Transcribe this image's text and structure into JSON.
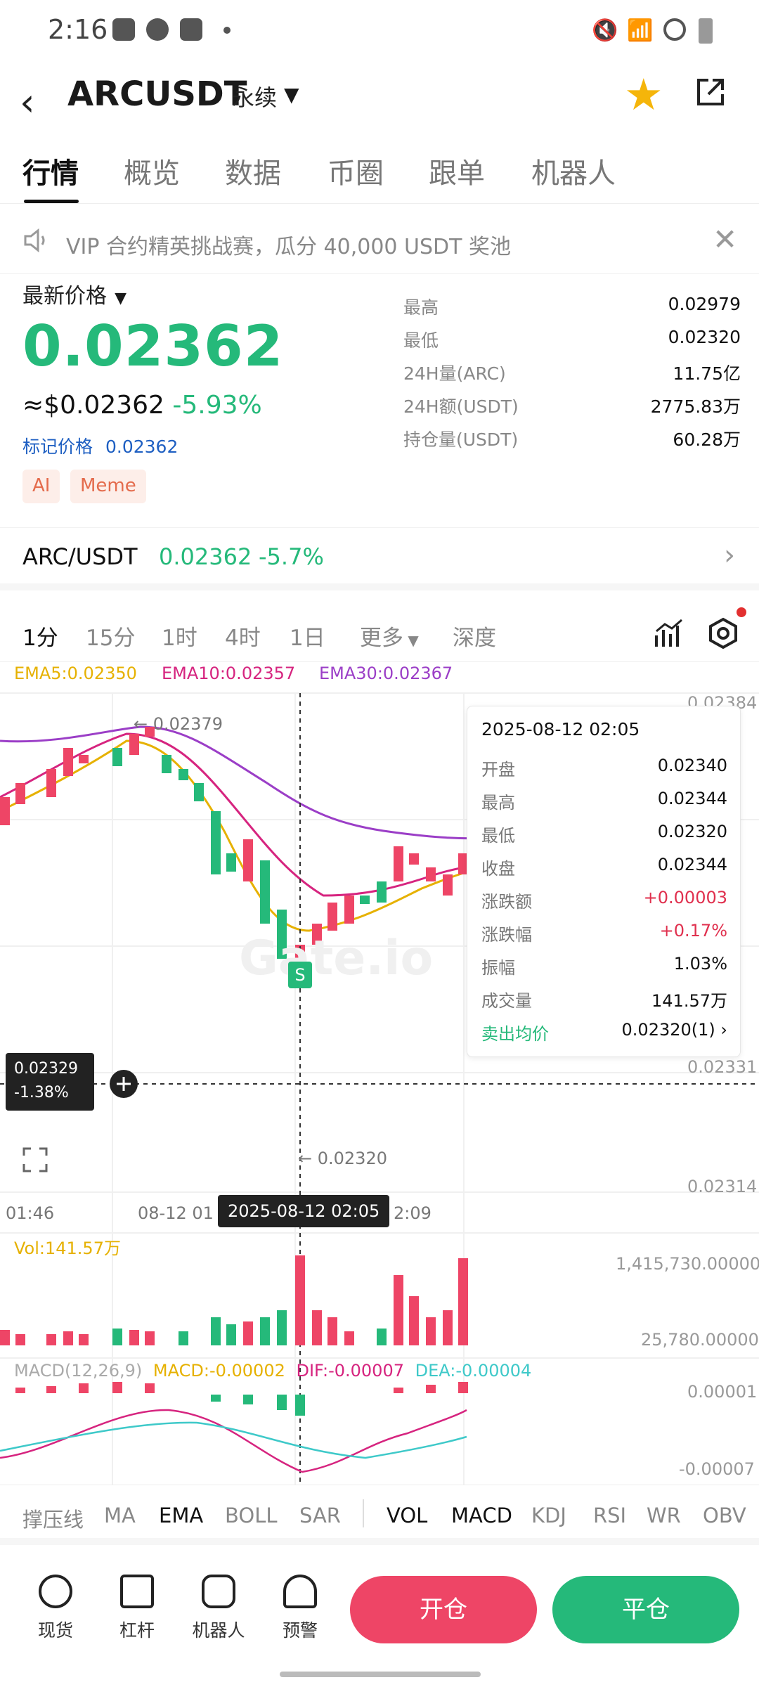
{
  "status_bar": {
    "time": "2:16"
  },
  "header": {
    "symbol": "ARCUSDT",
    "contract": "永续"
  },
  "tabs": [
    "行情",
    "概览",
    "数据",
    "币圈",
    "跟单",
    "机器人"
  ],
  "notice": "VIP 合约精英挑战赛，瓜分 40,000 USDT 奖池",
  "price": {
    "latest_label": "最新价格",
    "last": "0.02362",
    "usd": "≈$0.02362",
    "change": "-5.93%",
    "mark_label": "标记价格",
    "mark_value": "0.02362",
    "tags": [
      "AI",
      "Meme"
    ]
  },
  "stats": [
    {
      "k": "最高",
      "v": "0.02979"
    },
    {
      "k": "最低",
      "v": "0.02320"
    },
    {
      "k": "24H量(ARC)",
      "v": "11.75亿"
    },
    {
      "k": "24H额(USDT)",
      "v": "2775.83万"
    },
    {
      "k": "持仓量(USDT)",
      "v": "60.28万"
    }
  ],
  "spot_pair": {
    "name": "ARC/USDT",
    "price": "0.02362",
    "change": "-5.7%"
  },
  "timeframes": [
    "1分",
    "15分",
    "1时",
    "4时",
    "1日",
    "更多",
    "深度"
  ],
  "ema": {
    "ema5": "EMA5:0.02350",
    "ema10": "EMA10:0.02357",
    "ema30": "EMA30:0.02367"
  },
  "watermark": "Gate.io",
  "chart_labels": {
    "hi_mark": "← 0.02379",
    "lo_mark": "← 0.02320",
    "y_top": "0.02384",
    "y_mid": "0.02331",
    "y_bot": "0.02314",
    "cross_price": "0.02329",
    "cross_pct": "-1.38%",
    "x1": "01:46",
    "x2": "08-12 01",
    "x3": "2:09",
    "cross_time": "2025-08-12 02:05",
    "signal": "S"
  },
  "tooltip": {
    "datetime": "2025-08-12 02:05",
    "rows": [
      {
        "k": "开盘",
        "v": "0.02340"
      },
      {
        "k": "最高",
        "v": "0.02344"
      },
      {
        "k": "最低",
        "v": "0.02320"
      },
      {
        "k": "收盘",
        "v": "0.02344"
      },
      {
        "k": "涨跌额",
        "v": "+0.00003"
      },
      {
        "k": "涨跌幅",
        "v": "+0.17%"
      },
      {
        "k": "振幅",
        "v": "1.03%"
      },
      {
        "k": "成交量",
        "v": "141.57万"
      },
      {
        "k": "卖出均价",
        "v": "0.02320(1) ›"
      }
    ]
  },
  "volume": {
    "label": "Vol:141.57万",
    "max": "1,415,730.00000",
    "min": "25,780.00000"
  },
  "macd": {
    "label": "MACD(12,26,9)",
    "macd": "MACD:-0.00002",
    "dif": "DIF:-0.00007",
    "dea": "DEA:-0.00004",
    "top": "0.00001",
    "bot": "-0.00007"
  },
  "indicators": [
    "撑压线",
    "MA",
    "EMA",
    "BOLL",
    "SAR",
    "VOL",
    "MACD",
    "KDJ",
    "RSI",
    "WR",
    "OBV"
  ],
  "bottom_nav": [
    "现货",
    "杠杆",
    "机器人",
    "预警"
  ],
  "actions": {
    "open": "开仓",
    "close": "平仓"
  },
  "colors": {
    "green": "#25b97a",
    "red": "#ee4566",
    "star": "#f5b50a",
    "ema5": "#e6b100",
    "ema10": "#d6247f",
    "ema30": "#9b3ec7"
  }
}
